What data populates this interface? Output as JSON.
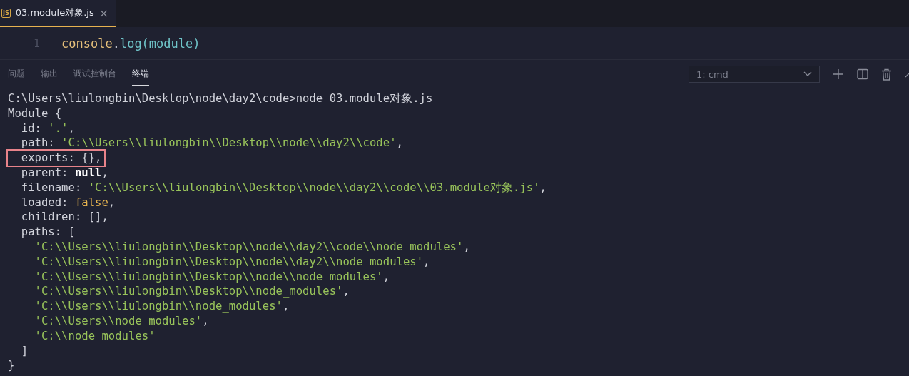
{
  "editor_tabs": [
    {
      "icon": "JS",
      "label": "03.module对象.js",
      "close": "×",
      "selected": true
    }
  ],
  "editor": {
    "lines": [
      {
        "number": "1",
        "tokens": [
          {
            "kind": "object",
            "text": "console"
          },
          {
            "kind": "punct",
            "text": "."
          },
          {
            "kind": "func",
            "text": "log(module)"
          }
        ]
      }
    ]
  },
  "panel": {
    "tabs": [
      {
        "label": "问题",
        "selected": false
      },
      {
        "label": "输出",
        "selected": false
      },
      {
        "label": "调试控制台",
        "selected": false
      },
      {
        "label": "终端",
        "selected": true
      }
    ],
    "terminal_select": {
      "value": "1: cmd"
    }
  },
  "terminal": {
    "lines": [
      {
        "highlighted": false,
        "tokens": [
          {
            "kind": "plain",
            "text": "C:\\Users\\liulongbin\\Desktop\\node\\day2\\code>node 03.module对象.js"
          }
        ]
      },
      {
        "highlighted": false,
        "tokens": [
          {
            "kind": "plain",
            "text": "Module {"
          }
        ]
      },
      {
        "highlighted": false,
        "tokens": [
          {
            "kind": "plain",
            "text": "  id: "
          },
          {
            "kind": "string",
            "text": "'.'"
          },
          {
            "kind": "plain",
            "text": ","
          }
        ]
      },
      {
        "highlighted": false,
        "tokens": [
          {
            "kind": "plain",
            "text": "  path: "
          },
          {
            "kind": "string",
            "text": "'C:\\\\Users\\\\liulongbin\\\\Desktop\\\\node\\\\day2\\\\code'"
          },
          {
            "kind": "plain",
            "text": ","
          }
        ]
      },
      {
        "highlighted": true,
        "tokens": [
          {
            "kind": "plain",
            "text": "  exports: {},"
          }
        ]
      },
      {
        "highlighted": false,
        "tokens": [
          {
            "kind": "plain",
            "text": "  parent: "
          },
          {
            "kind": "null",
            "text": "null"
          },
          {
            "kind": "plain",
            "text": ","
          }
        ]
      },
      {
        "highlighted": false,
        "tokens": [
          {
            "kind": "plain",
            "text": "  filename: "
          },
          {
            "kind": "string",
            "text": "'C:\\\\Users\\\\liulongbin\\\\Desktop\\\\node\\\\day2\\\\code\\\\03.module对象.js'"
          },
          {
            "kind": "plain",
            "text": ","
          }
        ]
      },
      {
        "highlighted": false,
        "tokens": [
          {
            "kind": "plain",
            "text": "  loaded: "
          },
          {
            "kind": "boolean",
            "text": "false"
          },
          {
            "kind": "plain",
            "text": ","
          }
        ]
      },
      {
        "highlighted": false,
        "tokens": [
          {
            "kind": "plain",
            "text": "  children: [],"
          }
        ]
      },
      {
        "highlighted": false,
        "tokens": [
          {
            "kind": "plain",
            "text": "  paths: ["
          }
        ]
      },
      {
        "highlighted": false,
        "tokens": [
          {
            "kind": "string",
            "text": "    'C:\\\\Users\\\\liulongbin\\\\Desktop\\\\node\\\\day2\\\\code\\\\node_modules'"
          },
          {
            "kind": "plain",
            "text": ","
          }
        ]
      },
      {
        "highlighted": false,
        "tokens": [
          {
            "kind": "string",
            "text": "    'C:\\\\Users\\\\liulongbin\\\\Desktop\\\\node\\\\day2\\\\node_modules'"
          },
          {
            "kind": "plain",
            "text": ","
          }
        ]
      },
      {
        "highlighted": false,
        "tokens": [
          {
            "kind": "string",
            "text": "    'C:\\\\Users\\\\liulongbin\\\\Desktop\\\\node\\\\node_modules'"
          },
          {
            "kind": "plain",
            "text": ","
          }
        ]
      },
      {
        "highlighted": false,
        "tokens": [
          {
            "kind": "string",
            "text": "    'C:\\\\Users\\\\liulongbin\\\\Desktop\\\\node_modules'"
          },
          {
            "kind": "plain",
            "text": ","
          }
        ]
      },
      {
        "highlighted": false,
        "tokens": [
          {
            "kind": "string",
            "text": "    'C:\\\\Users\\\\liulongbin\\\\node_modules'"
          },
          {
            "kind": "plain",
            "text": ","
          }
        ]
      },
      {
        "highlighted": false,
        "tokens": [
          {
            "kind": "string",
            "text": "    'C:\\\\Users\\\\node_modules'"
          },
          {
            "kind": "plain",
            "text": ","
          }
        ]
      },
      {
        "highlighted": false,
        "tokens": [
          {
            "kind": "string",
            "text": "    'C:\\\\node_modules'"
          }
        ]
      },
      {
        "highlighted": false,
        "tokens": [
          {
            "kind": "plain",
            "text": "  ]"
          }
        ]
      },
      {
        "highlighted": false,
        "tokens": [
          {
            "kind": "plain",
            "text": "}"
          }
        ]
      }
    ]
  }
}
